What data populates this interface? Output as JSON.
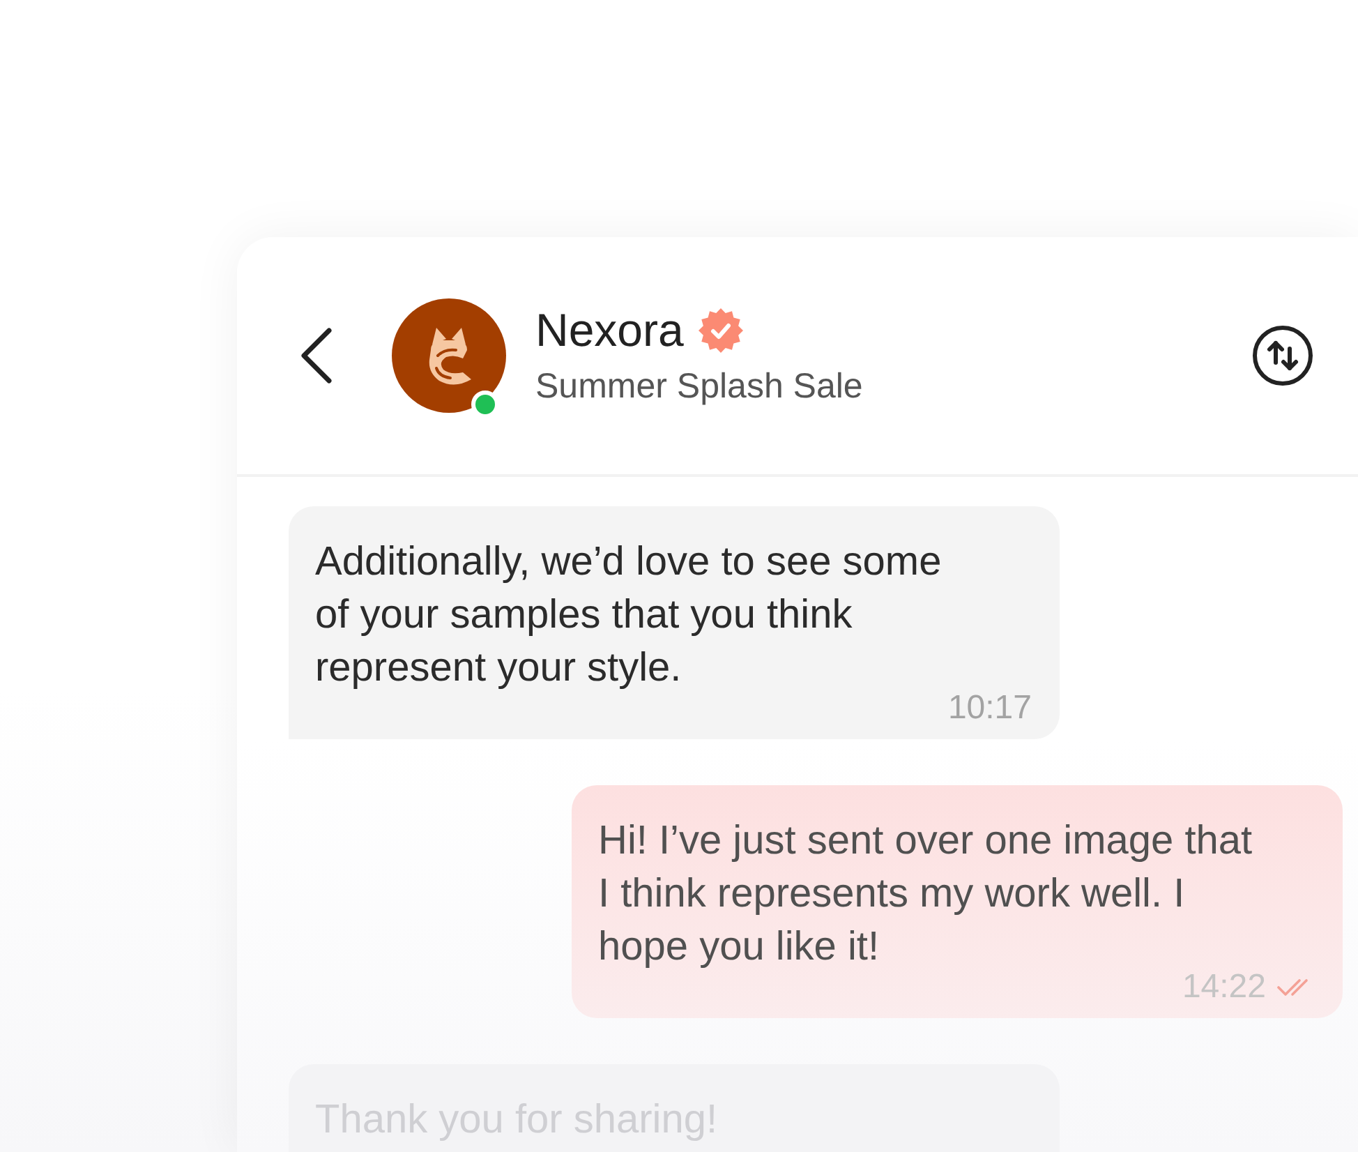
{
  "contact": {
    "name": "Nexora",
    "verified": true,
    "online": true,
    "subtitle": "Summer Splash Sale"
  },
  "messages": [
    {
      "kind": "incoming",
      "text": "Additionally, we’d love to see some of your samples that you think represent your style.",
      "time": "10:17"
    },
    {
      "kind": "outgoing",
      "text": "Hi! I’ve just sent over one image that I think represents my work well. I hope you like it!",
      "time": "14:22",
      "read": true
    },
    {
      "kind": "incoming",
      "text": "Thank you for sharing!"
    }
  ]
}
